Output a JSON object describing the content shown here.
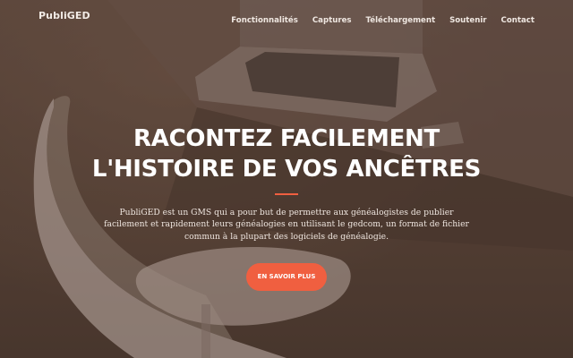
{
  "nav": {
    "brand": "PubliGED",
    "items": [
      {
        "label": "Fonctionnalités"
      },
      {
        "label": "Captures"
      },
      {
        "label": "Téléchargement"
      },
      {
        "label": "Soutenir"
      },
      {
        "label": "Contact"
      }
    ]
  },
  "hero": {
    "headline_line1": "RACONTEZ FACILEMENT",
    "headline_line2": "L'HISTOIRE DE VOS ANCÊTRES",
    "lead": "PubliGED est un GMS qui a pour but de permettre aux généalogistes de publier facilement et rapidement leurs généalogies en utilisant le gedcom, un format de fichier commun à la plupart des logiciels de généalogie.",
    "cta_label": "EN SAVOIR PLUS"
  },
  "colors": {
    "accent": "#f05f40",
    "overlay": "#583e30"
  }
}
